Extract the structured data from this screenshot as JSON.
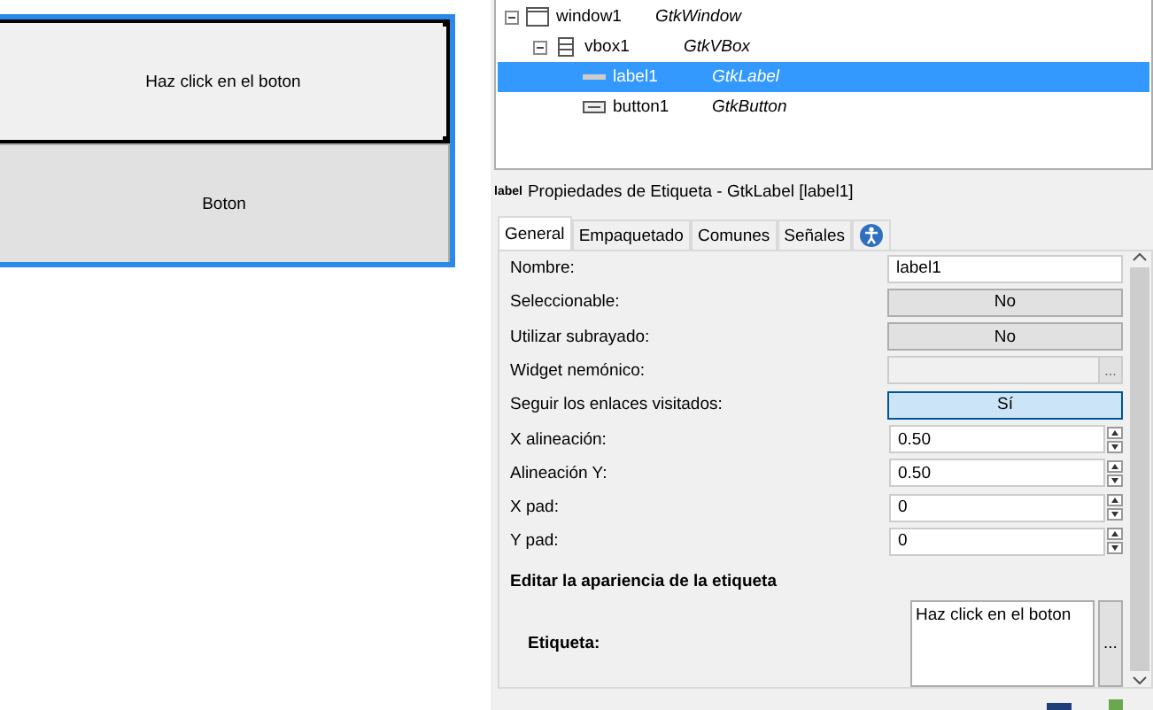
{
  "designer": {
    "label_widget": {
      "text": "Haz click en el boton",
      "selected": true
    },
    "button_widget": {
      "text": "Boton"
    }
  },
  "tree": [
    {
      "name": "window1",
      "type": "GtkWindow",
      "kind": "window",
      "selected": false,
      "expanded": true,
      "children": [
        {
          "name": "vbox1",
          "type": "GtkVBox",
          "kind": "vbox",
          "selected": false,
          "expanded": true,
          "children": [
            {
              "name": "label1",
              "type": "GtkLabel",
              "kind": "label",
              "selected": true
            },
            {
              "name": "button1",
              "type": "GtkButton",
              "kind": "button",
              "selected": false
            }
          ]
        }
      ]
    }
  ],
  "properties_header": {
    "icon_text": "label",
    "title": "Propiedades de Etiqueta - GtkLabel [label1]"
  },
  "tabs": [
    {
      "label": "General",
      "selected": true
    },
    {
      "label": "Empaquetado",
      "selected": false
    },
    {
      "label": "Comunes",
      "selected": false
    },
    {
      "label": "Señales",
      "selected": false
    },
    {
      "kind": "accessibility",
      "selected": false
    }
  ],
  "properties": [
    {
      "kind": "entry",
      "label": "Nombre:",
      "value": "label1"
    },
    {
      "kind": "toggle",
      "label": "Seleccionable:",
      "value": "No",
      "active": false
    },
    {
      "kind": "toggle",
      "label": "Utilizar subrayado:",
      "value": "No",
      "active": false
    },
    {
      "kind": "picker",
      "label": "Widget nemónico:",
      "button": "..."
    },
    {
      "kind": "toggle",
      "label": "Seguir los enlaces visitados:",
      "value": "Sí",
      "active": true
    },
    {
      "kind": "spin",
      "label": "X alineación:",
      "value": "0.50"
    },
    {
      "kind": "spin",
      "label": "Alineación Y:",
      "value": "0.50"
    },
    {
      "kind": "spin",
      "label": "X pad:",
      "value": "0"
    },
    {
      "kind": "spin",
      "label": "Y pad:",
      "value": "0"
    },
    {
      "kind": "section",
      "label": "Editar la apariencia de la etiqueta"
    },
    {
      "kind": "textarea",
      "label": "Etiqueta:",
      "value": "Haz click en el boton",
      "button": "..."
    }
  ]
}
